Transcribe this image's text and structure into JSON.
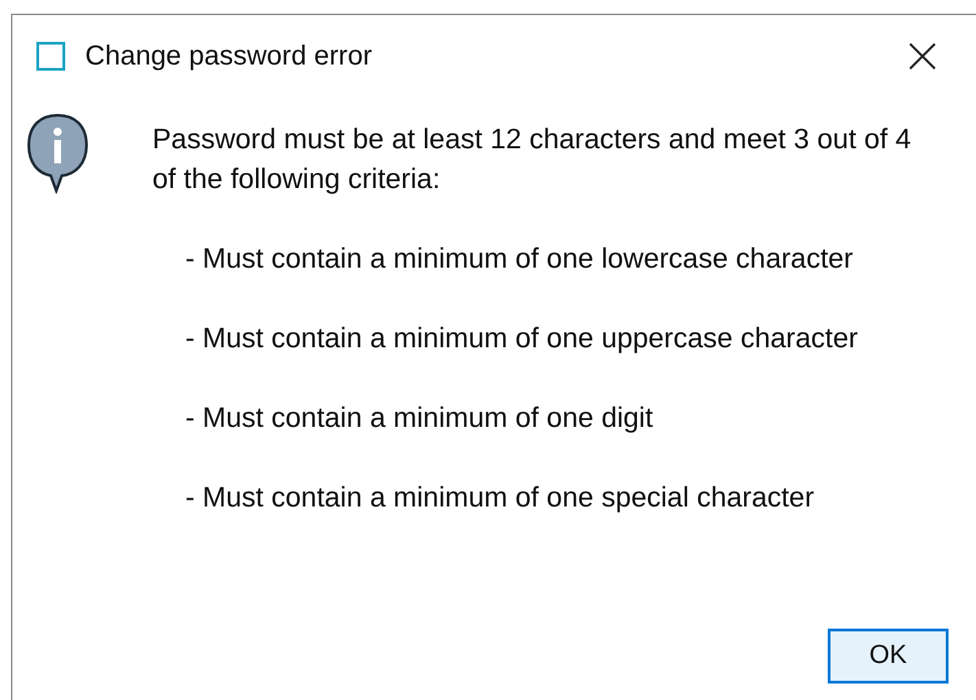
{
  "window": {
    "title": "Change password error"
  },
  "message": {
    "intro": "Password must be at least 12 characters and meet 3 out of 4 of the following criteria:",
    "criteria": [
      "- Must contain a minimum of one lowercase character",
      "- Must contain a minimum of one uppercase character",
      "- Must contain a minimum of one digit",
      "- Must contain a minimum of one special character"
    ]
  },
  "buttons": [
    {
      "label": "OK",
      "selected": true
    }
  ]
}
